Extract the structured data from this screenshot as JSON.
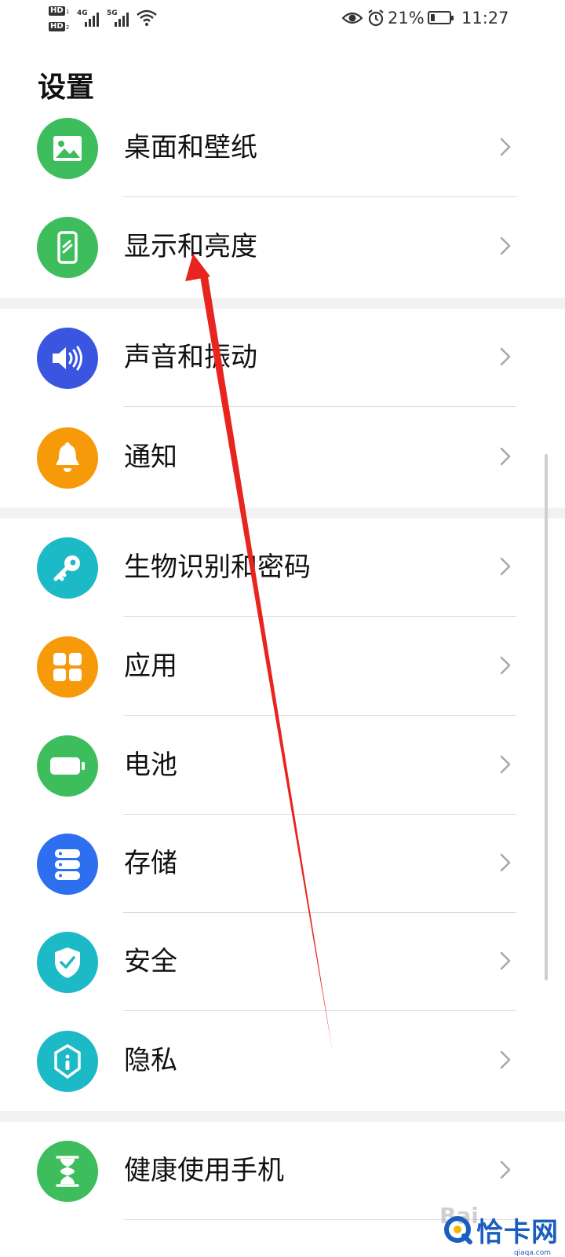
{
  "status_bar": {
    "hd1": "HD",
    "hd1_sub": "1",
    "hd2": "HD",
    "hd2_sub": "2",
    "net1": "4G",
    "net2": "5G",
    "battery_percent": "21%",
    "battery_level": 0.21,
    "time": "11:27",
    "icons": [
      "eye-icon",
      "alarm-icon",
      "battery-icon",
      "wifi-icon",
      "signal-icon"
    ]
  },
  "page_title": "设置",
  "items": [
    {
      "label": "桌面和壁纸",
      "icon": "wallpaper-icon",
      "color": "#3dbd5b"
    },
    {
      "label": "显示和亮度",
      "icon": "phone-brightness-icon",
      "color": "#3dbd5b"
    },
    {
      "label": "声音和振动",
      "icon": "speaker-icon",
      "color": "#3a56e0"
    },
    {
      "label": "通知",
      "icon": "bell-icon",
      "color": "#f79a0a"
    },
    {
      "label": "生物识别和密码",
      "icon": "key-icon",
      "color": "#1cb9c6"
    },
    {
      "label": "应用",
      "icon": "apps-grid-icon",
      "color": "#f79a0a"
    },
    {
      "label": "电池",
      "icon": "battery-icon",
      "color": "#3dbd5b"
    },
    {
      "label": "存储",
      "icon": "storage-icon",
      "color": "#2e6ff0"
    },
    {
      "label": "安全",
      "icon": "shield-check-icon",
      "color": "#1cb9c6"
    },
    {
      "label": "隐私",
      "icon": "privacy-lock-icon",
      "color": "#1cb9c6"
    },
    {
      "label": "健康使用手机",
      "icon": "hourglass-icon",
      "color": "#3dbd5b"
    }
  ],
  "annotation_color": "#e8241f",
  "watermark": {
    "brand": "恰卡网",
    "domain": "qiaqa.com",
    "baidu": "Bai"
  }
}
